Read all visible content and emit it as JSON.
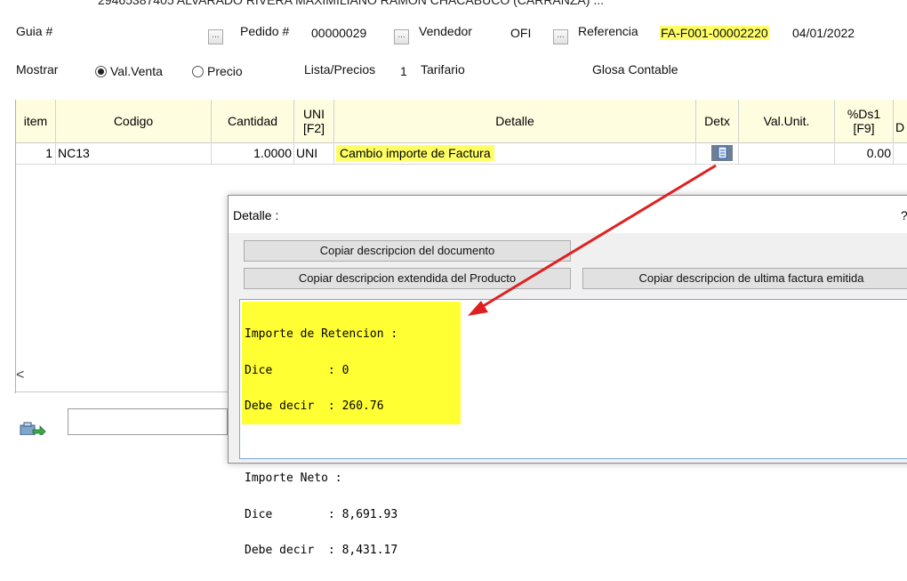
{
  "header": {
    "cut_text": "29465387405   ALVARADO RIVERA MAXIMILIANO RAMÓN CHACABUCO (CARRANZA)  ...",
    "guia_label": "Guia #",
    "pedido_label": "Pedido #",
    "pedido_value": "00000029",
    "vendedor_label": "Vendedor",
    "vendedor_value": "OFI",
    "referencia_label": "Referencia",
    "referencia_value": "FA-F001-00002220",
    "referencia_date": "04/01/2022",
    "dots": "..."
  },
  "options": {
    "mostrar_label": "Mostrar",
    "radio_valventa": "Val.Venta",
    "radio_precio": "Precio",
    "lista_label": "Lista/Precios",
    "lista_number": "1",
    "lista_value": "Tarifario",
    "glosa_label": "Glosa Contable"
  },
  "grid": {
    "headers": {
      "item": "item",
      "codigo": "Codigo",
      "cantidad": "Cantidad",
      "uni": "UNI",
      "uni_key": "[F2]",
      "detalle": "Detalle",
      "detx": "Detx",
      "valunit": "Val.Unit.",
      "ds1": "%Ds1",
      "ds1_key": "[F9]",
      "next": "D"
    },
    "row": {
      "item": "1",
      "codigo": "NC13",
      "cantidad": "1.0000",
      "uni": "UNI",
      "detalle": "Cambio importe de Factura",
      "ds1": "0.00"
    }
  },
  "scroll_left_arrow": "<",
  "dialog": {
    "title": "Detalle :",
    "help": "?",
    "btn_copy_doc": "Copiar descripcion del documento",
    "btn_copy_ext": "Copiar descripcion extendida del Producto",
    "btn_copy_last": "Copiar descripcion de ultima factura emitida",
    "memo_lines": [
      "Importe de Retencion :",
      "Dice        : 0",
      "Debe decir  : 260.76",
      "",
      "Importe Neto :",
      "Dice        : 8,691.93",
      "Debe decir  : 8,431.17"
    ]
  },
  "colors": {
    "highlight": "#ffff66",
    "memo_highlight": "#ffff33",
    "arrow": "#e02020",
    "grid_header_bg": "#fffde0"
  }
}
